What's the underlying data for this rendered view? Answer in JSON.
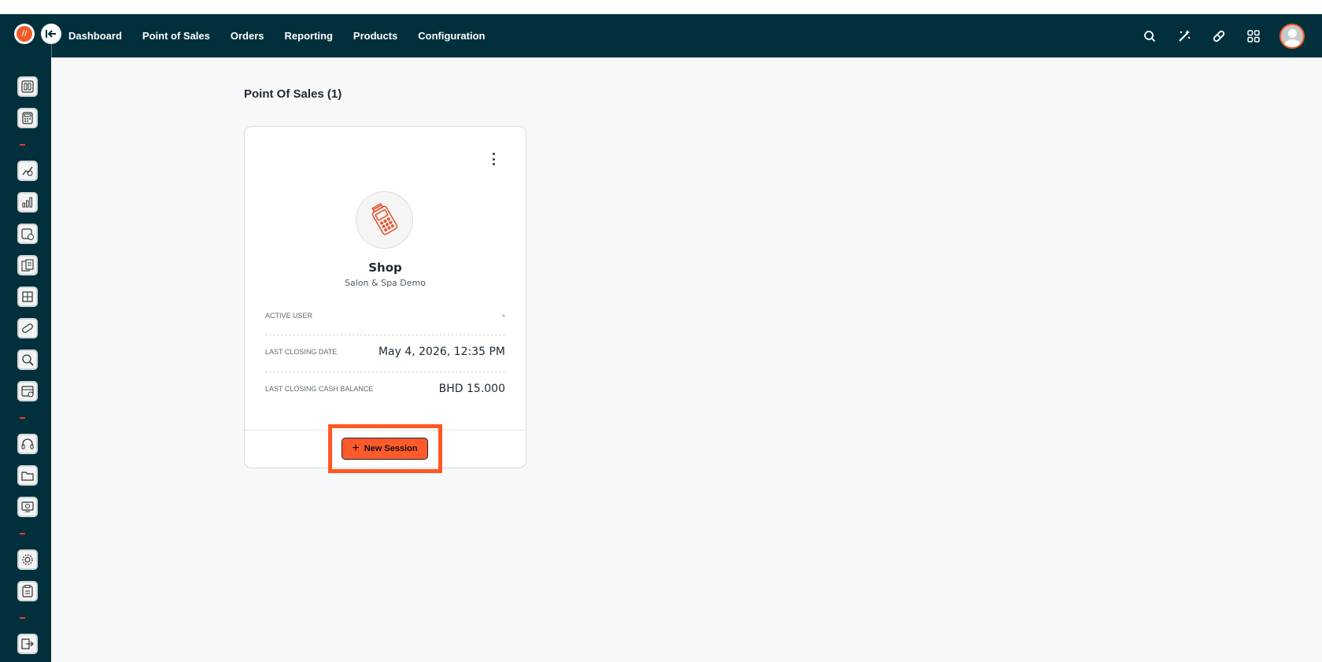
{
  "nav": {
    "items": [
      "Dashboard",
      "Point of Sales",
      "Orders",
      "Reporting",
      "Products",
      "Configuration"
    ]
  },
  "header_icons": [
    "search-icon",
    "magic-wand-icon",
    "pill-icon",
    "apps-grid-icon",
    "user-avatar"
  ],
  "sidebar": {
    "icons": [
      "pos-dashboard-icon",
      "calculator-icon",
      "sales-chart-icon",
      "bar-chart-icon",
      "clock-report-icon",
      "documents-icon",
      "box-icon",
      "pill-icon",
      "search-report-icon",
      "calendar-icon",
      "headset-icon",
      "folder-icon",
      "monitor-icon",
      "settings-icon",
      "clipboard-icon",
      "logout-icon"
    ]
  },
  "page": {
    "title": "Point Of Sales (1)"
  },
  "card": {
    "name": "Shop",
    "subtitle": "Salon & Spa Demo",
    "active_user_label": "ACTIVE USER",
    "active_user_value": "-",
    "last_closing_date_label": "LAST CLOSING DATE",
    "last_closing_date_value": "May 4, 2026, 12:35 PM",
    "last_closing_cash_label": "LAST CLOSING CASH BALANCE",
    "last_closing_cash_value": "BHD 15.000",
    "new_session_label": "New Session",
    "new_session_icon": "+"
  },
  "colors": {
    "topbar": "#01303c",
    "accent": "#ff5a2c",
    "highlight": "#ff5722"
  }
}
